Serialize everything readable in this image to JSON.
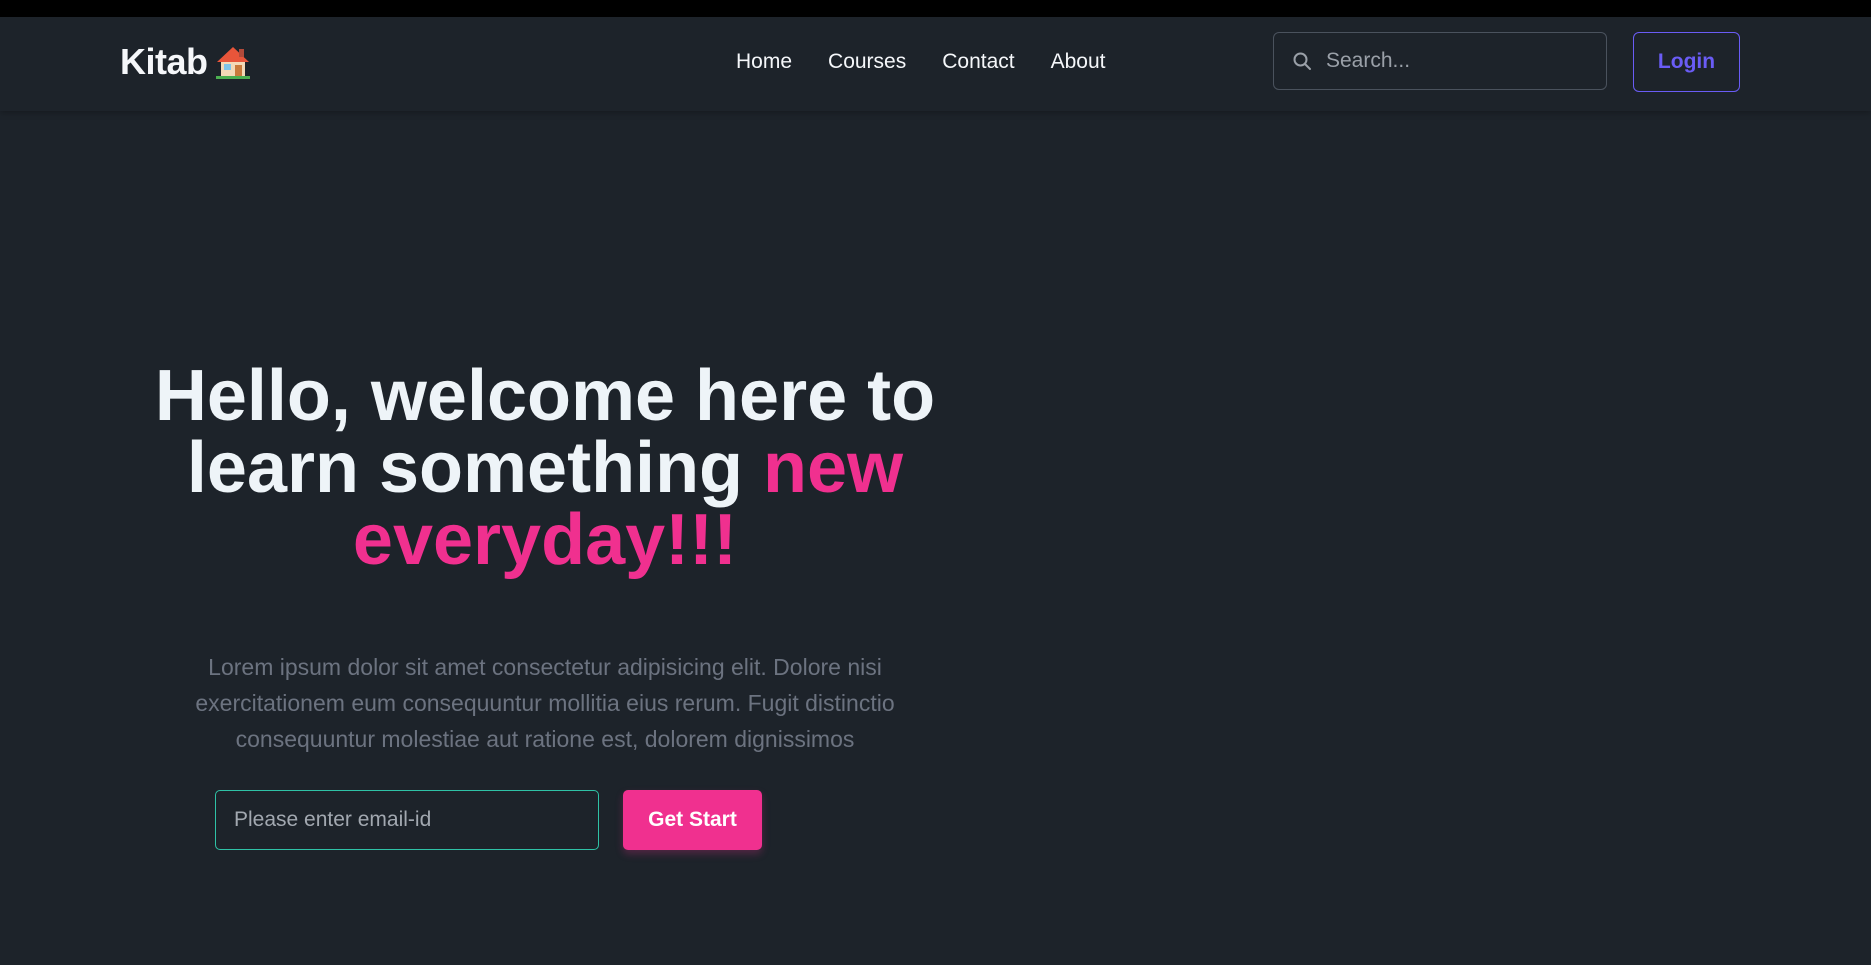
{
  "brand": {
    "name": "Kitab",
    "icon": "house-icon"
  },
  "nav": {
    "links": [
      {
        "label": "Home"
      },
      {
        "label": "Courses"
      },
      {
        "label": "Contact"
      },
      {
        "label": "About"
      }
    ]
  },
  "search": {
    "placeholder": "Search...",
    "icon": "search-icon"
  },
  "login": {
    "label": "Login"
  },
  "hero": {
    "headline_part1": "Hello, welcome here to learn something ",
    "headline_accent": "new everyday!!!",
    "description": "Lorem ipsum dolor sit amet consectetur adipisicing elit. Dolore nisi exercitationem eum consequuntur mollitia eius rerum. Fugit distinctio consequuntur molestiae aut ratione est, dolorem dignissimos",
    "email_placeholder": "Please enter email-id",
    "cta_label": "Get Start"
  },
  "colors": {
    "background": "#1d232a",
    "accent_pink": "#f0308f",
    "login_purple": "#6a5cf5",
    "email_border_teal": "#2fc2a6"
  }
}
